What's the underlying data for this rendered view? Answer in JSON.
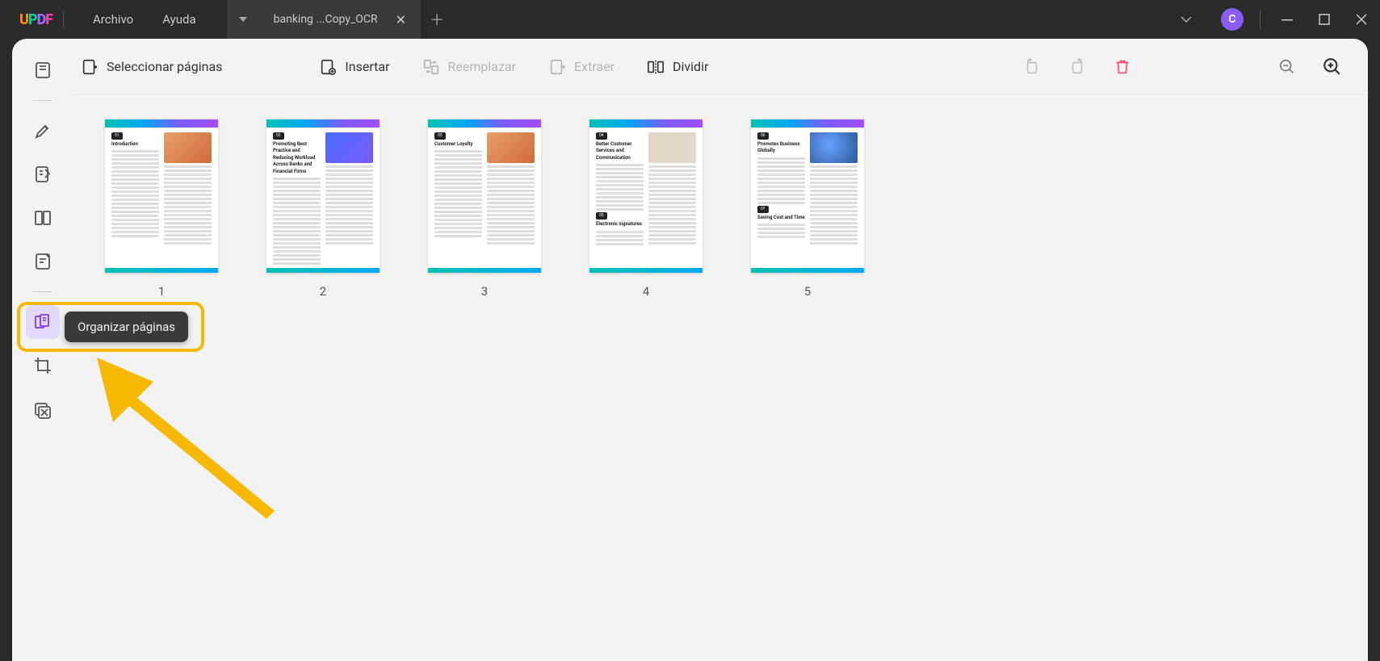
{
  "app": {
    "logo_text": "UPDF"
  },
  "menu": {
    "file": "Archivo",
    "help": "Ayuda"
  },
  "tab": {
    "title": "banking ...Copy_OCR"
  },
  "titlebar_avatar": "C",
  "actions": {
    "select_pages": "Seleccionar páginas",
    "insert": "Insertar",
    "replace": "Reemplazar",
    "extract": "Extraer",
    "split": "Dividir"
  },
  "tooltip": {
    "organize_pages": "Organizar páginas"
  },
  "pages": [
    {
      "number": "1",
      "tag": "01",
      "title": "Introduction",
      "img": "person"
    },
    {
      "number": "2",
      "tag": "02",
      "title": "Promoting Best Practice and Reducing Workload Across Banks and Financial Firms",
      "img": "blue"
    },
    {
      "number": "3",
      "tag": "03",
      "title": "Customer Loyalty",
      "img": "person"
    },
    {
      "number": "4",
      "tag": "04",
      "title": "Better Customer Services and Communication",
      "tag2": "05",
      "title2": "Electronic signatures",
      "img": "paper"
    },
    {
      "number": "5",
      "tag": "06",
      "title": "Promotes Business Globally",
      "tag2": "07",
      "title2": "Saving Cost and Time",
      "img": "globe"
    }
  ]
}
